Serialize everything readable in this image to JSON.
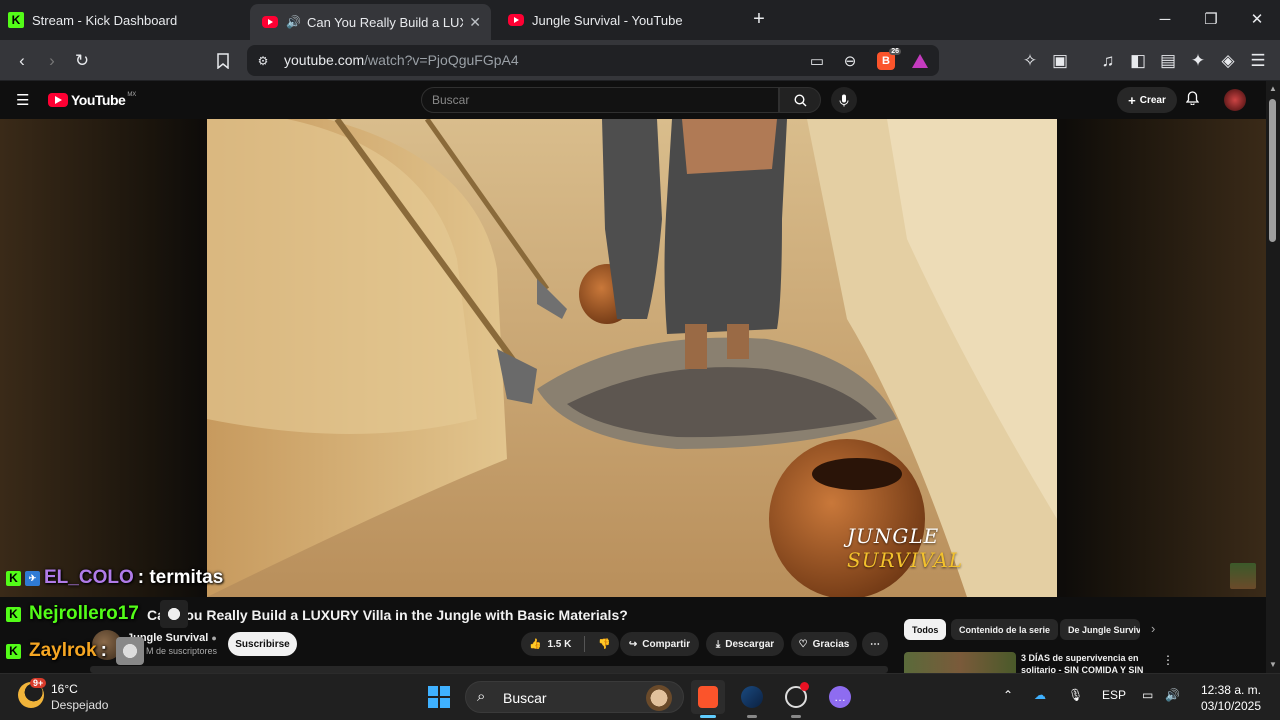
{
  "browser": {
    "tabs": [
      {
        "title": "Stream - Kick Dashboard",
        "icon": "kick-icon",
        "active": false
      },
      {
        "title": "Can You Really Build a LUXURY",
        "icon": "youtube-icon",
        "active": true,
        "audio_icon": "speaker-icon"
      },
      {
        "title": "Jungle Survival - YouTube",
        "icon": "youtube-icon",
        "active": false
      }
    ],
    "url_host": "youtube.com",
    "url_path": "/watch?v=PjoQguFGpA4",
    "brave_shield_count": "26"
  },
  "youtube": {
    "logo_text": "YouTube",
    "country_code": "MX",
    "search_placeholder": "Buscar",
    "create_label": "Crear"
  },
  "video": {
    "watermark_part1": "JUNGLE ",
    "watermark_part2": "SURVIVAL",
    "title": "Can You Really Build a LUXURY Villa in the Jungle with Basic Materials?",
    "channel_name": "Jungle Survival",
    "subscribers": "M de suscriptores",
    "subscribe_label": "Suscribirse",
    "likes": "1.5 K",
    "share_label": "Compartir",
    "download_label": "Descargar",
    "thanks_label": "Gracias"
  },
  "sidebar": {
    "chips": [
      "Todos",
      "Contenido de la serie",
      "De Jungle Survival"
    ],
    "rec_title": "3 DÍAS de supervivencia en solitario - SIN COMIDA Y SIN"
  },
  "chat": [
    {
      "user": "EL_COLO",
      "message": ": termitas",
      "color": "#b07be8"
    },
    {
      "user": "Nejrollero17",
      "message": "",
      "color": "#53fc18"
    },
    {
      "user": "Zaylrok",
      "message": ":",
      "color": "#f5a623"
    }
  ],
  "taskbar": {
    "weather_badge": "9+",
    "temperature": "16°C",
    "weather": "Despejado",
    "search_label": "Buscar",
    "language": "ESP",
    "time": "12:38 a. m.",
    "date": "03/10/2025"
  },
  "colors": {
    "kick_green": "#53fc18",
    "youtube_red": "#ff0033",
    "brave_orange": "#fb542b"
  }
}
